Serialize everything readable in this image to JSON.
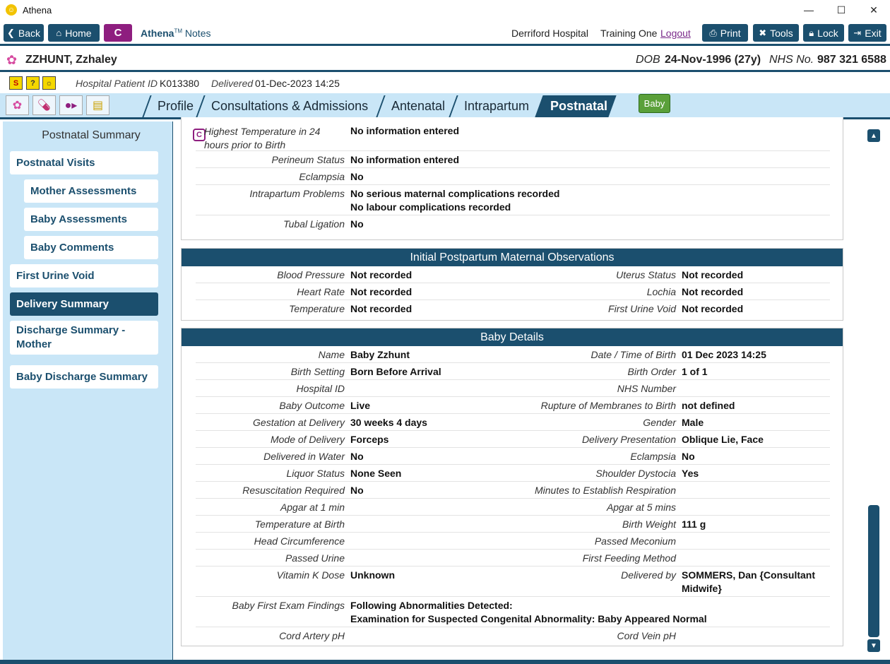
{
  "window": {
    "title": "Athena",
    "minimize": "—",
    "maximize": "☐",
    "close": "✕"
  },
  "toolbar": {
    "back": "Back",
    "home": "Home",
    "c_badge": "C",
    "app_name_bold": "Athena",
    "app_name_tm": "TM",
    "app_name_rest": " Notes",
    "hospital": "Derriford Hospital",
    "user": "Training One",
    "logout": "Logout",
    "print": "Print",
    "tools": "Tools",
    "lock": "Lock",
    "exit": "Exit"
  },
  "patient": {
    "name": "ZZHUNT, Zzhaley",
    "dob_label": "DOB",
    "dob_value": "24-Nov-1996 (27y)",
    "nhs_label": "NHS No.",
    "nhs_value": "987 321 6588"
  },
  "subheader": {
    "hospital_id_label": "Hospital Patient ID",
    "hospital_id_value": "K013380",
    "delivered_label": "Delivered",
    "delivered_value": "01-Dec-2023 14:25"
  },
  "tabs": [
    {
      "label": "Profile"
    },
    {
      "label": "Consultations & Admissions"
    },
    {
      "label": "Antenatal"
    },
    {
      "label": "Intrapartum"
    },
    {
      "label": "Postnatal"
    }
  ],
  "baby_button": "Baby",
  "sidebar": {
    "title": "Postnatal Summary",
    "items": [
      {
        "label": "Postnatal Visits"
      },
      {
        "label": "Mother Assessments"
      },
      {
        "label": "Baby Assessments"
      },
      {
        "label": "Baby Comments"
      },
      {
        "label": "First Urine Void"
      },
      {
        "label": "Delivery Summary"
      },
      {
        "label": "Discharge Summary - Mother"
      },
      {
        "label": "Baby Discharge Summary"
      }
    ]
  },
  "intrapartum_panel": {
    "c_mark": "C",
    "rows": [
      {
        "label": "Highest Temperature in 24 hours prior to Birth",
        "value": "No information entered"
      },
      {
        "label": "Perineum Status",
        "value": "No information entered"
      },
      {
        "label": "Eclampsia",
        "value": "No"
      },
      {
        "label": "Intrapartum Problems",
        "value": "No serious maternal complications recorded",
        "value2": "No labour complications recorded"
      },
      {
        "label": "Tubal Ligation",
        "value": "No"
      }
    ]
  },
  "maternal_obs": {
    "title": "Initial Postpartum Maternal Observations",
    "rows": [
      {
        "l1": "Blood Pressure",
        "v1": "Not recorded",
        "l2": "Uterus Status",
        "v2": "Not recorded"
      },
      {
        "l1": "Heart Rate",
        "v1": "Not recorded",
        "l2": "Lochia",
        "v2": "Not recorded"
      },
      {
        "l1": "Temperature",
        "v1": "Not recorded",
        "l2": "First Urine Void",
        "v2": "Not recorded"
      }
    ]
  },
  "baby_details": {
    "title": "Baby Details",
    "rows": [
      {
        "l1": "Name",
        "v1": "Baby Zzhunt",
        "l2": "Date / Time of Birth",
        "v2": "01 Dec 2023 14:25"
      },
      {
        "l1": "Birth Setting",
        "v1": "Born Before Arrival",
        "l2": "Birth Order",
        "v2": "1 of 1"
      },
      {
        "l1": "Hospital ID",
        "v1": "",
        "l2": "NHS Number",
        "v2": ""
      },
      {
        "l1": "Baby Outcome",
        "v1": "Live",
        "l2": "Rupture of Membranes to Birth",
        "v2": "not defined"
      },
      {
        "l1": "Gestation at Delivery",
        "v1": "30 weeks 4 days",
        "l2": "Gender",
        "v2": "Male"
      },
      {
        "l1": "Mode of Delivery",
        "v1": "Forceps",
        "l2": "Delivery Presentation",
        "v2": "Oblique Lie, Face"
      },
      {
        "l1": "Delivered in Water",
        "v1": "No",
        "l2": "Eclampsia",
        "v2": "No"
      },
      {
        "l1": "Liquor Status",
        "v1": "None Seen",
        "l2": "Shoulder Dystocia",
        "v2": "Yes"
      },
      {
        "l1": "Resuscitation Required",
        "v1": "No",
        "l2": "Minutes to Establish Respiration",
        "v2": ""
      },
      {
        "l1": "Apgar at 1 min",
        "v1": "",
        "l2": "Apgar at 5 mins",
        "v2": ""
      },
      {
        "l1": "Temperature at Birth",
        "v1": "",
        "l2": "Birth Weight",
        "v2": "111 g"
      },
      {
        "l1": "Head Circumference",
        "v1": "",
        "l2": "Passed Meconium",
        "v2": ""
      },
      {
        "l1": "Passed Urine",
        "v1": "",
        "l2": "First Feeding Method",
        "v2": ""
      },
      {
        "l1": "Vitamin K Dose",
        "v1": "Unknown",
        "l2": "Delivered by",
        "v2": "SOMMERS, Dan {Consultant",
        "v2b": "Midwife}"
      },
      {
        "l1": "Baby First Exam Findings",
        "v1": "Following Abnormalities Detected:",
        "v1b": "Examination for Suspected Congenital Abnormality: Baby Appeared Normal",
        "l2": "",
        "v2": ""
      },
      {
        "l1": "Cord Artery pH",
        "v1": "",
        "l2": "Cord Vein pH",
        "v2": ""
      }
    ]
  },
  "scrollbar": {
    "up": "▲",
    "down": "▼",
    "position": 0.72
  }
}
